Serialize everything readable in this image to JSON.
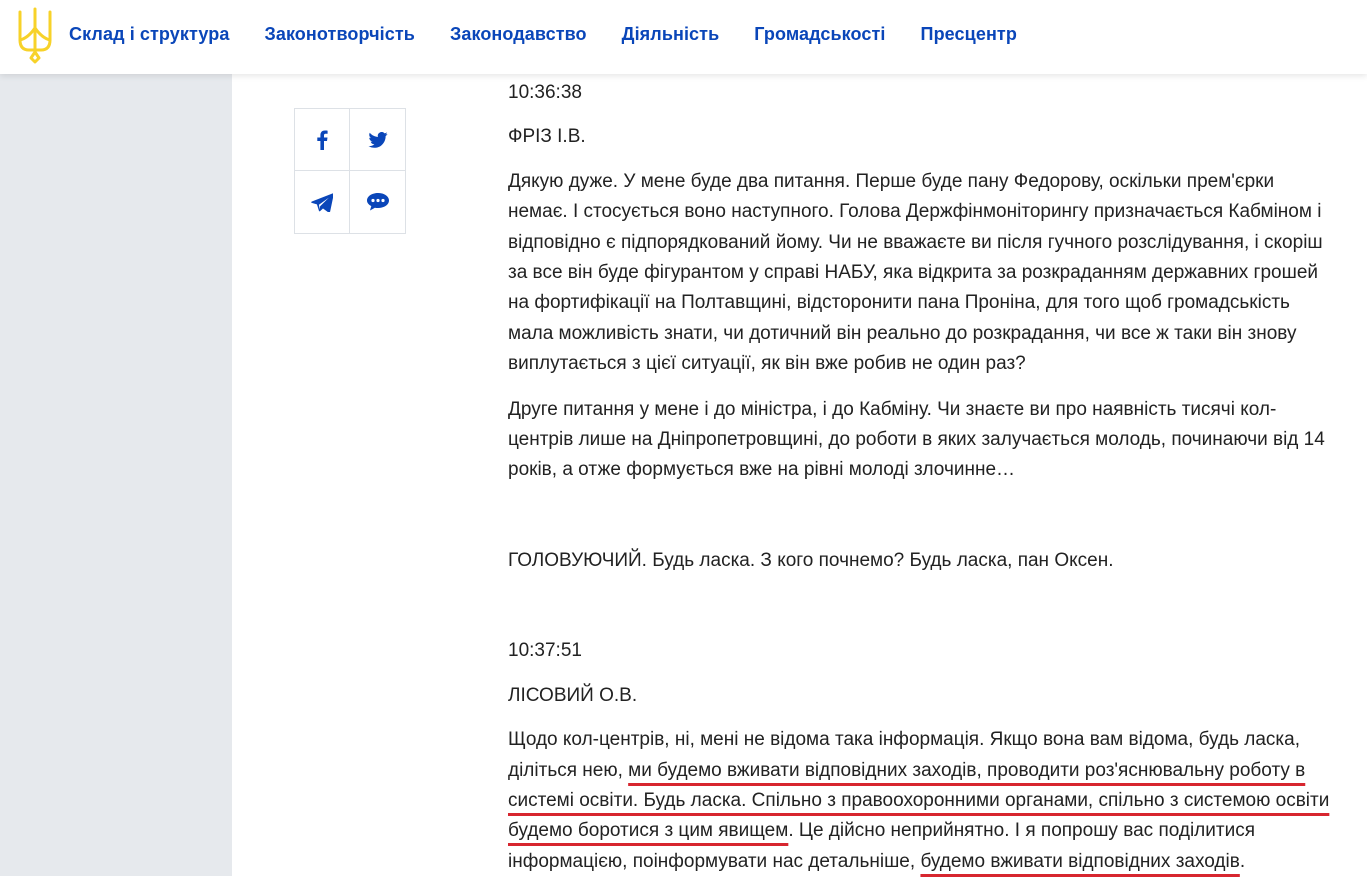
{
  "nav": {
    "items": [
      "Склад і структура",
      "Законотворчість",
      "Законодавство",
      "Діяльність",
      "Громадськості",
      "Пресцентр"
    ]
  },
  "colors": {
    "nav_link": "#0a46b9",
    "emblem": "#f7d229",
    "share_icon": "#0a46b9",
    "underline": "#d7262f",
    "left_panel": "#e6e9ed"
  },
  "share": {
    "icons": [
      "facebook-icon",
      "twitter-icon",
      "telegram-icon",
      "comment-icon"
    ]
  },
  "transcript": {
    "block1": {
      "time": "10:36:38",
      "speaker": "ФРІЗ І.В.",
      "p1": "Дякую дуже. У мене буде два питання. Перше буде пану Федорову, оскільки прем'єрки немає. І стосується воно наступного. Голова Держфінмоніторингу призначається Кабміном і відповідно є підпорядкований йому. Чи не вважаєте ви після гучного розслідування, і скоріш за все він буде фігурантом у справі НАБУ, яка відкрита за розкраданням державних грошей на фортифікації на Полтавщині, відсторонити пана Проніна, для того щоб громадськість мала можливість знати, чи дотичний він реально до розкрадання, чи все ж таки він знову виплутається з цієї ситуації, як він вже робив не один раз?",
      "p2": "Друге питання у мене і до міністра, і до Кабміну. Чи знаєте ви про наявність тисячі кол-центрів лише на Дніпропетровщині, до роботи в яких залучається молодь, починаючи від 14 років, а отже формується вже на рівні молоді злочинне…"
    },
    "chair": "ГОЛОВУЮЧИЙ. Будь ласка. З кого почнемо? Будь ласка, пан Оксен.",
    "block2": {
      "time": "10:37:51",
      "speaker": "ЛІСОВИЙ О.В.",
      "p_a": "Щодо кол-центрів, ні, мені не відома така інформація. Якщо вона вам відома, будь ласка, діліться нею, ",
      "p_b": "ми будемо вживати відповідних заходів, проводити роз'яснювальну роботу в системі освіти. Будь ласка. Спільно з правоохоронними органами, спільно з системою освіти будемо боротися з цим явищем",
      "p_c": ". Це дійсно неприйнятно. І я попрошу вас поділитися інформацією, поінформувати нас детальніше, ",
      "p_d": "будемо вживати відповідних заходів",
      "p_e": "."
    }
  }
}
